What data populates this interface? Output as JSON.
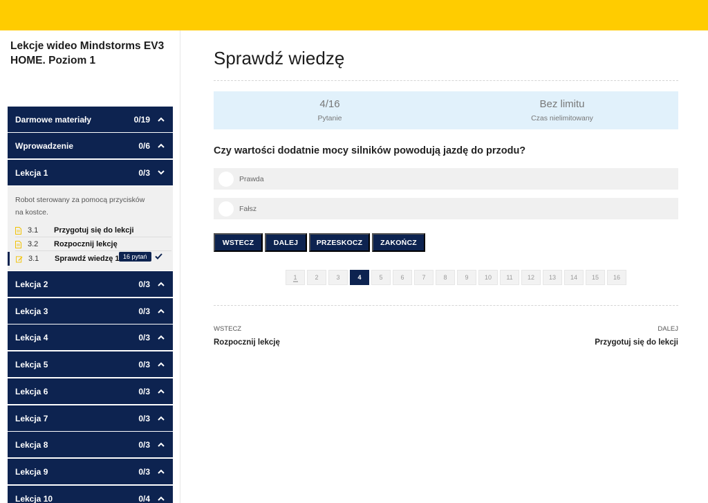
{
  "course": {
    "title": "Lekcje wideo Mindstorms EV3 HOME. Poziom 1"
  },
  "sidebar": {
    "sections": [
      {
        "label": "Darmowe materiały",
        "count": "0/19",
        "expanded": false
      },
      {
        "label": "Wprowadzenie",
        "count": "0/6",
        "expanded": false
      },
      {
        "label": "Lekcja 1",
        "count": "0/3",
        "expanded": true
      },
      {
        "label": "Lekcja 2",
        "count": "0/3",
        "expanded": false
      },
      {
        "label": "Lekcja 3",
        "count": "0/3",
        "expanded": false
      },
      {
        "label": "Lekcja 4",
        "count": "0/3",
        "expanded": false
      },
      {
        "label": "Lekcja 5",
        "count": "0/3",
        "expanded": false
      },
      {
        "label": "Lekcja 6",
        "count": "0/3",
        "expanded": false
      },
      {
        "label": "Lekcja 7",
        "count": "0/3",
        "expanded": false
      },
      {
        "label": "Lekcja 8",
        "count": "0/3",
        "expanded": false
      },
      {
        "label": "Lekcja 9",
        "count": "0/3",
        "expanded": false
      },
      {
        "label": "Lekcja 10",
        "count": "0/4",
        "expanded": false
      }
    ],
    "lesson1": {
      "description": "Robot sterowany za pomocą przycisków na kostce.",
      "items": [
        {
          "num": "3.1",
          "title": "Przygotuj się do lekcji",
          "icon": "document-icon"
        },
        {
          "num": "3.2",
          "title": "Rozpocznij lekcję",
          "icon": "document-icon"
        },
        {
          "num": "3.1",
          "title": "Sprawdź wiedzę 1",
          "icon": "edit-icon",
          "badge": "16 pytań",
          "active": true
        }
      ]
    }
  },
  "main": {
    "title": "Sprawdź wiedzę",
    "info": {
      "question_counter": "4/16",
      "question_label": "Pytanie",
      "time_value": "Bez limitu",
      "time_label": "Czas nielimitowany"
    },
    "question": "Czy wartości dodatnie mocy silników powodują jazdę do przodu?",
    "answers": [
      "Prawda",
      "Fałsz"
    ],
    "buttons": [
      "WSTECZ",
      "DALEJ",
      "PRZESKOCZ",
      "ZAKOŃCZ"
    ],
    "pages": [
      "1",
      "2",
      "3",
      "4",
      "5",
      "6",
      "7",
      "8",
      "9",
      "10",
      "11",
      "12",
      "13",
      "14",
      "15",
      "16"
    ],
    "current_page": "4",
    "nav": {
      "prev_label": "WSTECZ",
      "prev_title": "Rozpocznij lekcję",
      "next_label": "DALEJ",
      "next_title": "Przygotuj się do lekcji"
    }
  },
  "colors": {
    "accent": "#ffcc00",
    "navy": "#0d2350",
    "info_bg": "#e1f1fb",
    "icon_yellow": "#f2c200"
  }
}
